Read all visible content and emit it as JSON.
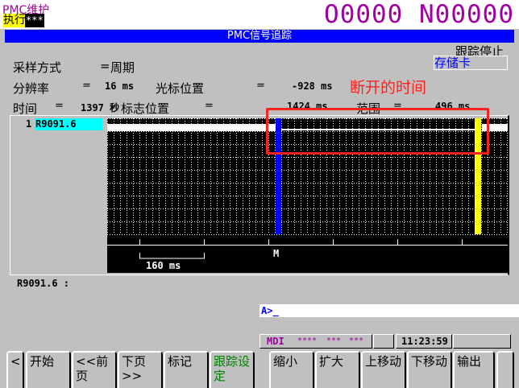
{
  "header": {
    "mode_title": "PMC维护",
    "status_label": "执行",
    "status_value": "***",
    "program_number": "O0000 N00000"
  },
  "title": "PMC信号追踪",
  "trace_state": "跟踪停止",
  "storage_button": "存储卡",
  "params": {
    "sampling_label": "采样方式",
    "sampling_eq": "=",
    "sampling_value": "周期",
    "resolution_label": "分辨率",
    "resolution_eq": "=",
    "resolution_value": "16 ms",
    "cursor_label": "光标位置",
    "cursor_eq": "=",
    "cursor_value": "-928 ms",
    "time_label": "时间",
    "time_eq": "=",
    "time_value": "1397 秒",
    "mark_label": "标志位置",
    "mark_eq": "=",
    "mark_value": "1424 ms",
    "range_label": "范围",
    "range_eq": "=",
    "range_value": "496 ms"
  },
  "annotation": {
    "text": "断开的时间",
    "color": "#ff2020"
  },
  "signals": [
    {
      "index": "1",
      "address": "R9091.6"
    }
  ],
  "chart": {
    "scale_label": "160 ms",
    "mark_label": "M",
    "cursor_color": "#0000ff",
    "mark_color": "#ffff00"
  },
  "status_signal": "R9091.6 :",
  "command_prompt": "A>_",
  "status_bar": {
    "mode": "MDI",
    "stars1": "****",
    "stars2": "***",
    "stars3": "***",
    "clock": "11:23:59"
  },
  "softkeys": [
    "<",
    "开始",
    "<<前页",
    "下页>>",
    "标记",
    "跟踪设定",
    "缩小",
    "扩大",
    "上移动",
    "下移动",
    "输出",
    ""
  ],
  "colors": {
    "title_bar": "#0000ff",
    "header_text": "#a000a0",
    "softkey_active": "#008000"
  }
}
